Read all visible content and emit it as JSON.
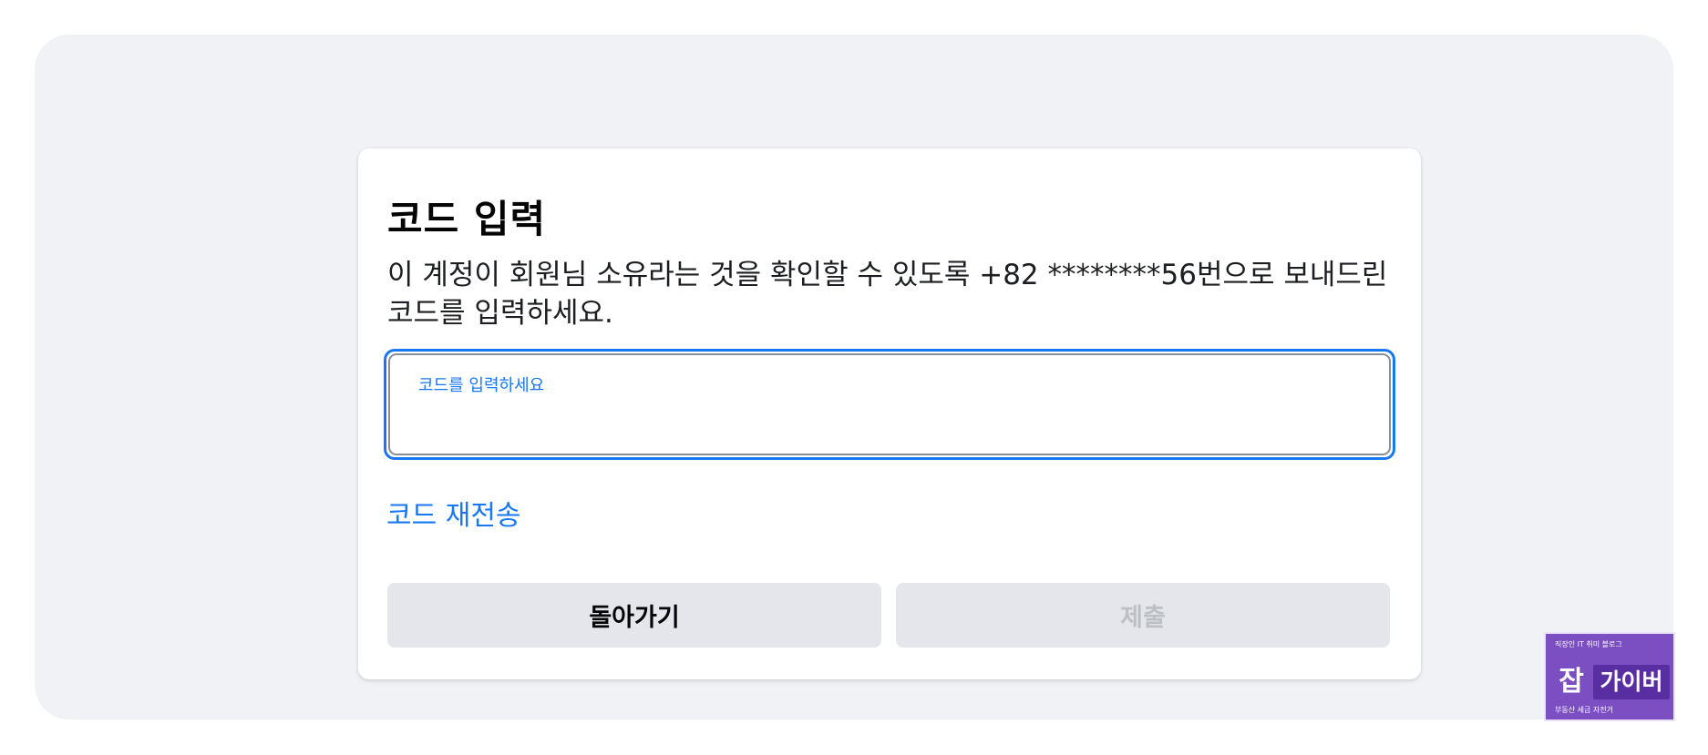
{
  "dialog": {
    "title": "코드 입력",
    "description": "이 계정이 회원님 소유라는 것을 확인할 수 있도록 +82 ********56번으로 보내드린 코드를 입력하세요.",
    "code_input": {
      "label": "코드를 입력하세요",
      "value": ""
    },
    "resend_link": "코드 재전송",
    "back_button": "돌아가기",
    "submit_button": "제출"
  },
  "watermark": {
    "top_text": "직장인 IT 취미 블로그",
    "main_left": "잡",
    "main_right": "가이버",
    "bottom_text": "부동산 세금 자전거"
  },
  "colors": {
    "accent": "#1877f2",
    "page_bg": "#f0f2f5",
    "button_bg": "#e4e6eb",
    "disabled_text": "#bcc0c4",
    "watermark_bg": "#7b4fc2"
  }
}
